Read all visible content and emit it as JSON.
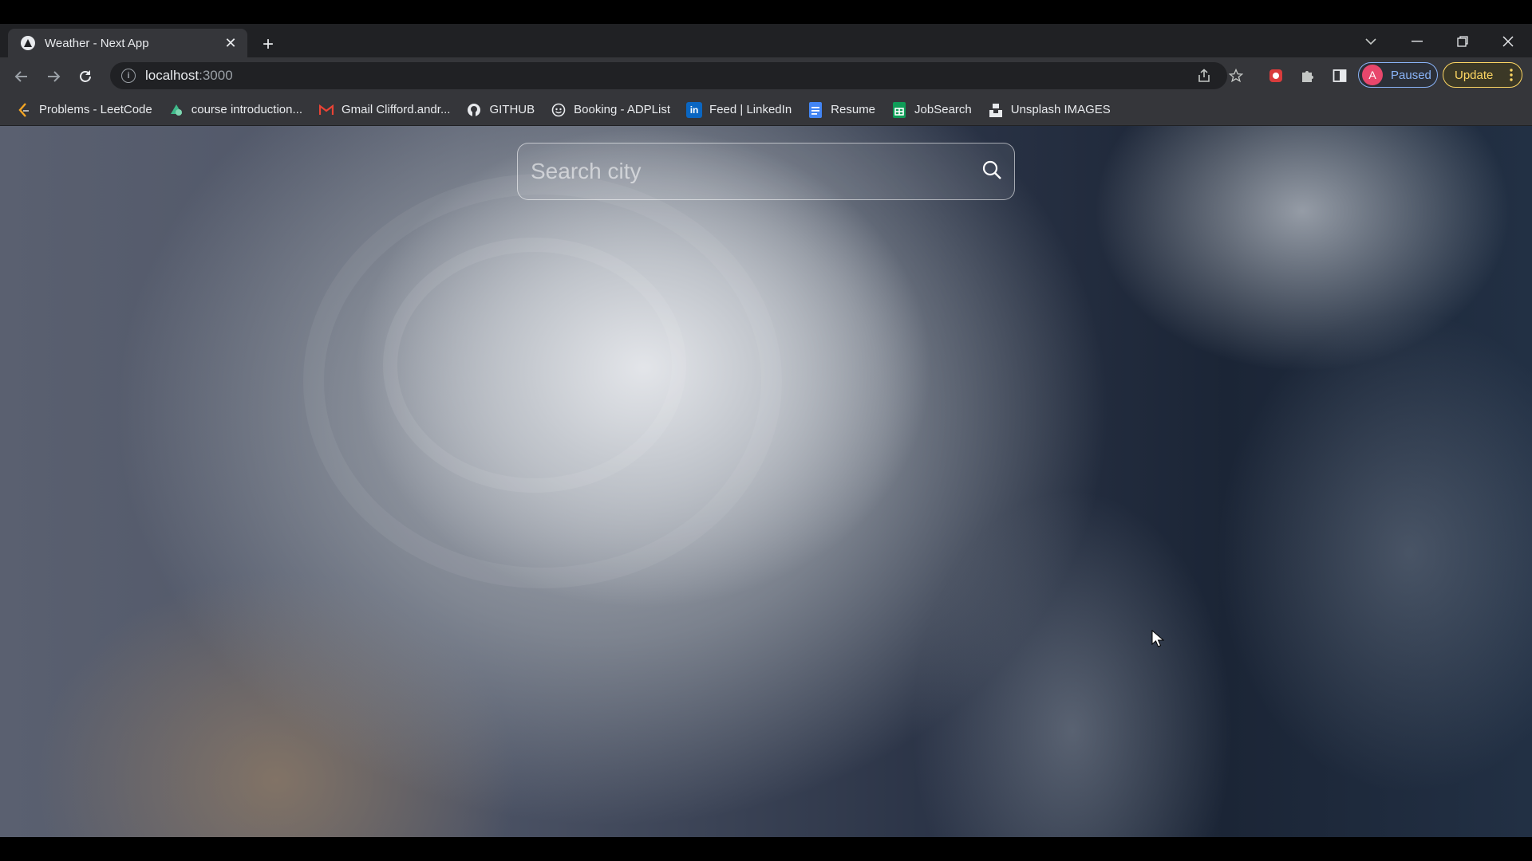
{
  "tab": {
    "title": "Weather - Next App",
    "close_glyph": "✕"
  },
  "new_tab_glyph": "+",
  "window": {
    "minimize": "—",
    "maximize": "❐",
    "close": "✕"
  },
  "address": {
    "host": "localhost",
    "port": ":3000"
  },
  "profile": {
    "initial": "A",
    "status": "Paused"
  },
  "update_label": "Update",
  "bookmarks": [
    {
      "label": "Problems - LeetCode",
      "icon": "leetcode-icon"
    },
    {
      "label": "course introduction...",
      "icon": "course-icon"
    },
    {
      "label": "Gmail Clifford.andr...",
      "icon": "gmail-icon"
    },
    {
      "label": "GITHUB",
      "icon": "github-icon"
    },
    {
      "label": "Booking - ADPList",
      "icon": "adplist-icon"
    },
    {
      "label": "Feed | LinkedIn",
      "icon": "linkedin-icon"
    },
    {
      "label": "Resume",
      "icon": "docs-icon"
    },
    {
      "label": "JobSearch",
      "icon": "sheets-icon"
    },
    {
      "label": "Unsplash IMAGES",
      "icon": "unsplash-icon"
    }
  ],
  "search": {
    "placeholder": "Search city",
    "value": ""
  },
  "colors": {
    "accent_profile": "#8ab4f8",
    "accent_update": "#fdd663",
    "avatar_bg": "#e8476c"
  }
}
